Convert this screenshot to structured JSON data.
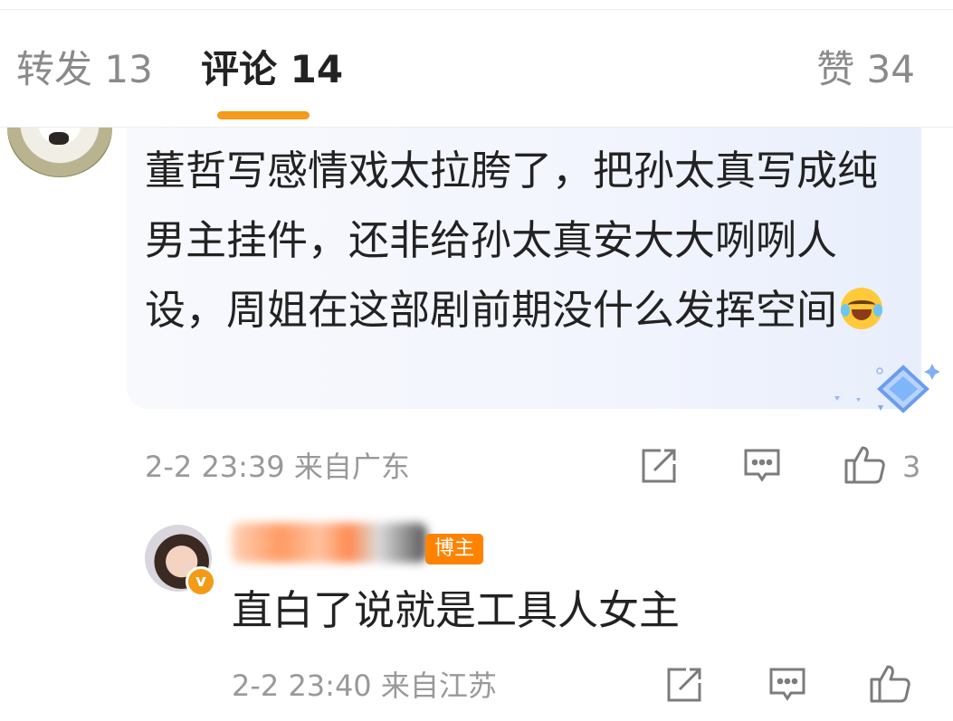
{
  "tabs": {
    "repost": "转发 13",
    "comment": "评论 14",
    "like": "赞 34"
  },
  "comment": {
    "text": "董哲写感情戏太拉胯了，把孙太真写成纯男主挂件，还非给孙太真安大大咧咧人设，周姐在这部剧前期没什么发挥空间",
    "emoji_icon": "laughing-tears-emoji",
    "meta": "2-2 23:39 来自广东",
    "like_count": "3"
  },
  "reply": {
    "author_badge": "博主",
    "verified_icon": "v-badge",
    "text": "直白了说就是工具人女主",
    "meta": "2-2 23:40 来自江苏"
  },
  "colors": {
    "accent": "#f59a19",
    "author_badge": "#ff8200",
    "meta_text": "#999999"
  }
}
